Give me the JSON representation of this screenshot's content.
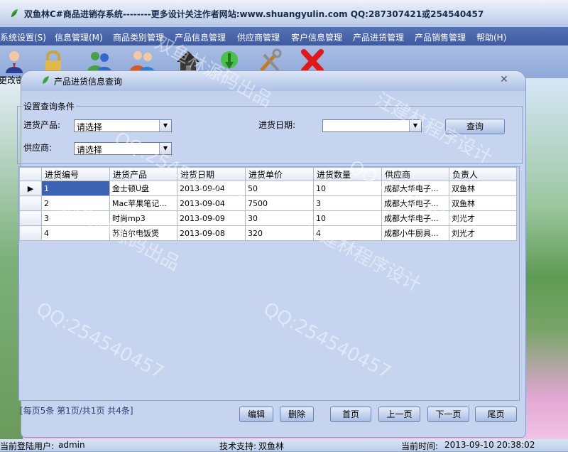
{
  "window": {
    "title": "双鱼林C#商品进销存系统--------更多设计关注作者网站:www.shuangyulin.com  QQ:287307421或254540457"
  },
  "menu": [
    "系统设置(S)",
    "信息管理(M)",
    "商品类别管理",
    "产品信息管理",
    "供应商管理",
    "客户信息管理",
    "产品进货管理",
    "产品销售管理",
    "帮助(H)"
  ],
  "toolbar": {
    "change_pwd_label": "更改密",
    "icons": [
      "user-icon",
      "lock-icon",
      "users-icon",
      "customers-icon",
      "home-icon",
      "refresh-icon",
      "tools-icon",
      "close-x-icon"
    ]
  },
  "child": {
    "title": "产品进货信息查询"
  },
  "query": {
    "group_title": "设置查询条件",
    "product_label": "进货产品:",
    "product_value": "请选择",
    "date_label": "进货日期:",
    "date_value": "",
    "supplier_label": "供应商:",
    "supplier_value": "请选择",
    "query_button": "查询"
  },
  "table": {
    "columns": [
      "进货编号",
      "进货产品",
      "进货日期",
      "进货单价",
      "进货数量",
      "供应商",
      "负责人"
    ],
    "rows": [
      [
        "1",
        "金士顿U盘",
        "2013-09-04",
        "50",
        "10",
        "成都大华电子...",
        "双鱼林"
      ],
      [
        "2",
        "Mac苹果笔记...",
        "2013-09-04",
        "7500",
        "3",
        "成都大华电子...",
        "双鱼林"
      ],
      [
        "3",
        "时尚mp3",
        "2013-09-09",
        "30",
        "10",
        "成都大华电子...",
        "刘光才"
      ],
      [
        "4",
        "苏泊尔电饭煲",
        "2013-09-08",
        "320",
        "4",
        "成都小牛厨具...",
        "刘光才"
      ]
    ],
    "current_row_marker": "▶"
  },
  "pager": {
    "info": "[每页5条  第1页/共1页    共4条]",
    "edit": "编辑",
    "delete": "删除",
    "first": "首页",
    "prev": "上一页",
    "next": "下一页",
    "last": "尾页"
  },
  "status": {
    "user_label": "当前登陆用户:",
    "user": "admin",
    "support_label": "技术支持:",
    "support": "双鱼林",
    "time_label": "当前时间:",
    "time": "2013-09-10 20:38:02"
  },
  "watermarks": [
    "双鱼林源码出品",
    "汪建林程序设计",
    "QQ:254540457"
  ]
}
